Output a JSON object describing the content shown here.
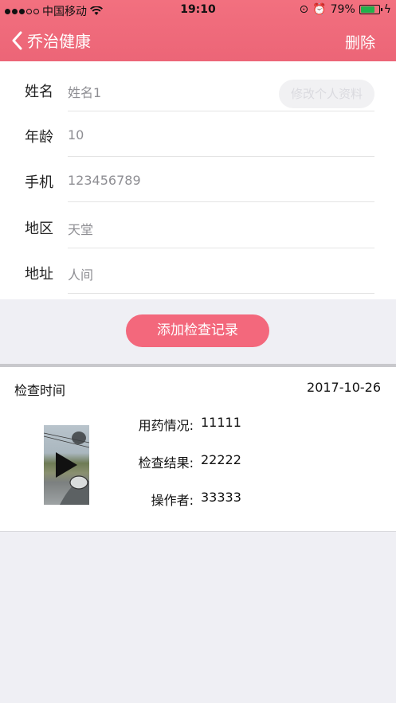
{
  "status_bar": {
    "carrier": "中国移动",
    "time": "19:10",
    "battery_percent": "79%",
    "battery_level": 0.79,
    "battery_color": "#22b14c"
  },
  "nav": {
    "back_label": "乔治健康",
    "right_label": "删除",
    "bg_color": "#ec6577"
  },
  "form": {
    "fields": [
      {
        "label": "姓名",
        "value": "姓名1"
      },
      {
        "label": "年龄",
        "value": "10"
      },
      {
        "label": "手机",
        "value": "123456789"
      },
      {
        "label": "地区",
        "value": "天堂"
      },
      {
        "label": "地址",
        "value": "人间"
      }
    ],
    "edit_button": "修改个人资料"
  },
  "add_record_button": "添加检查记录",
  "record": {
    "time_label": "检查时间",
    "date": "2017-10-26",
    "details": [
      {
        "key": "用药情况:",
        "value": "11111"
      },
      {
        "key": "检查结果:",
        "value": "22222"
      },
      {
        "key": "操作者:",
        "value": "33333"
      }
    ]
  }
}
